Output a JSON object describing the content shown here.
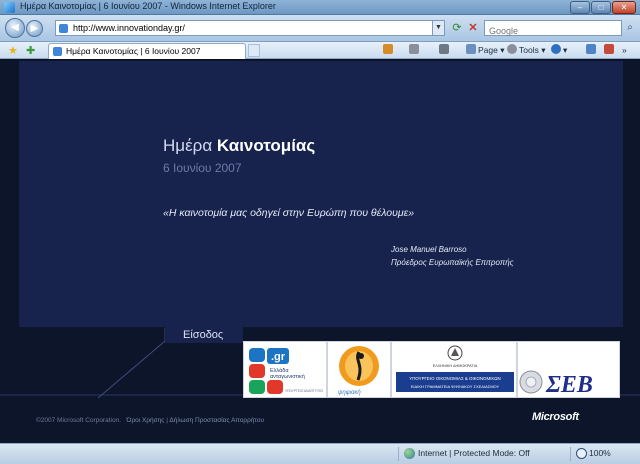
{
  "window": {
    "title": "Ημέρα Καινοτομίας | 6 Ιουνίου 2007 - Windows Internet Explorer",
    "controls": {
      "minimize": "–",
      "maximize": "□",
      "close": "✕"
    }
  },
  "addressbar": {
    "url": "http://www.innovationday.gr/",
    "search_placeholder": "Google"
  },
  "tabs": [
    {
      "label": "Ημέρα Καινοτομίας | 6 Ιουνίου 2007"
    }
  ],
  "commandbar": {
    "page_label": "Page",
    "tools_label": "Tools"
  },
  "page": {
    "headline_prefix": "Ημέρα ",
    "headline_bold": "Καινοτομίας",
    "date": "6 Ιουνίου 2007",
    "quote": "«Η καινοτομία μας οδηγεί στην Ευρώπη που θέλουμε»",
    "author_name": "Jose Manuel Barroso",
    "author_role": "Πρόεδρος Ευρωπαϊκής Επιτροπής",
    "login_label": "Είσοδος",
    "logos": {
      "gr": {
        "mark": ".gr",
        "line1": "Ελλάδα",
        "line2": "ανταγωνιστική",
        "line3": "ΥΠΟΥΡΓΕΙΟ ΑΝΑΠΤΥΞΗΣ"
      },
      "sph": {
        "caption": "ψηφιακή"
      },
      "ministry": {
        "line1": "ΕΛΛΗΝΙΚΗ ΔΗΜΟΚΡΑΤΙΑ",
        "line2": "ΥΠΟΥΡΓΕΙΟ ΟΙΚΟΝΟΜΙΑΣ & ΟΙΚΟΝΟΜΙΚΩΝ",
        "line3": "ΕΙΔΙΚΗ ΓΡΑΜΜΑΤΕΙΑ ΨΗΦΙΑΚΟΥ ΣΧΕΔΙΑΣΜΟΥ"
      },
      "seb": {
        "mark": "ΣΕΒ"
      }
    },
    "footer": {
      "copyright": "©2007 Microsoft Corporation.",
      "terms": "Όροι Χρήσης",
      "separator": "|",
      "privacy": "Δήλωση Προστασίας Απορρήτου",
      "brand": "Microsoft"
    }
  },
  "statusbar": {
    "zone": "Internet | Protected Mode: Off",
    "zoom": "100%"
  },
  "colors": {
    "banner": "#17224d",
    "page_bg": "#0d152b",
    "date_text": "#6b7aa7"
  }
}
